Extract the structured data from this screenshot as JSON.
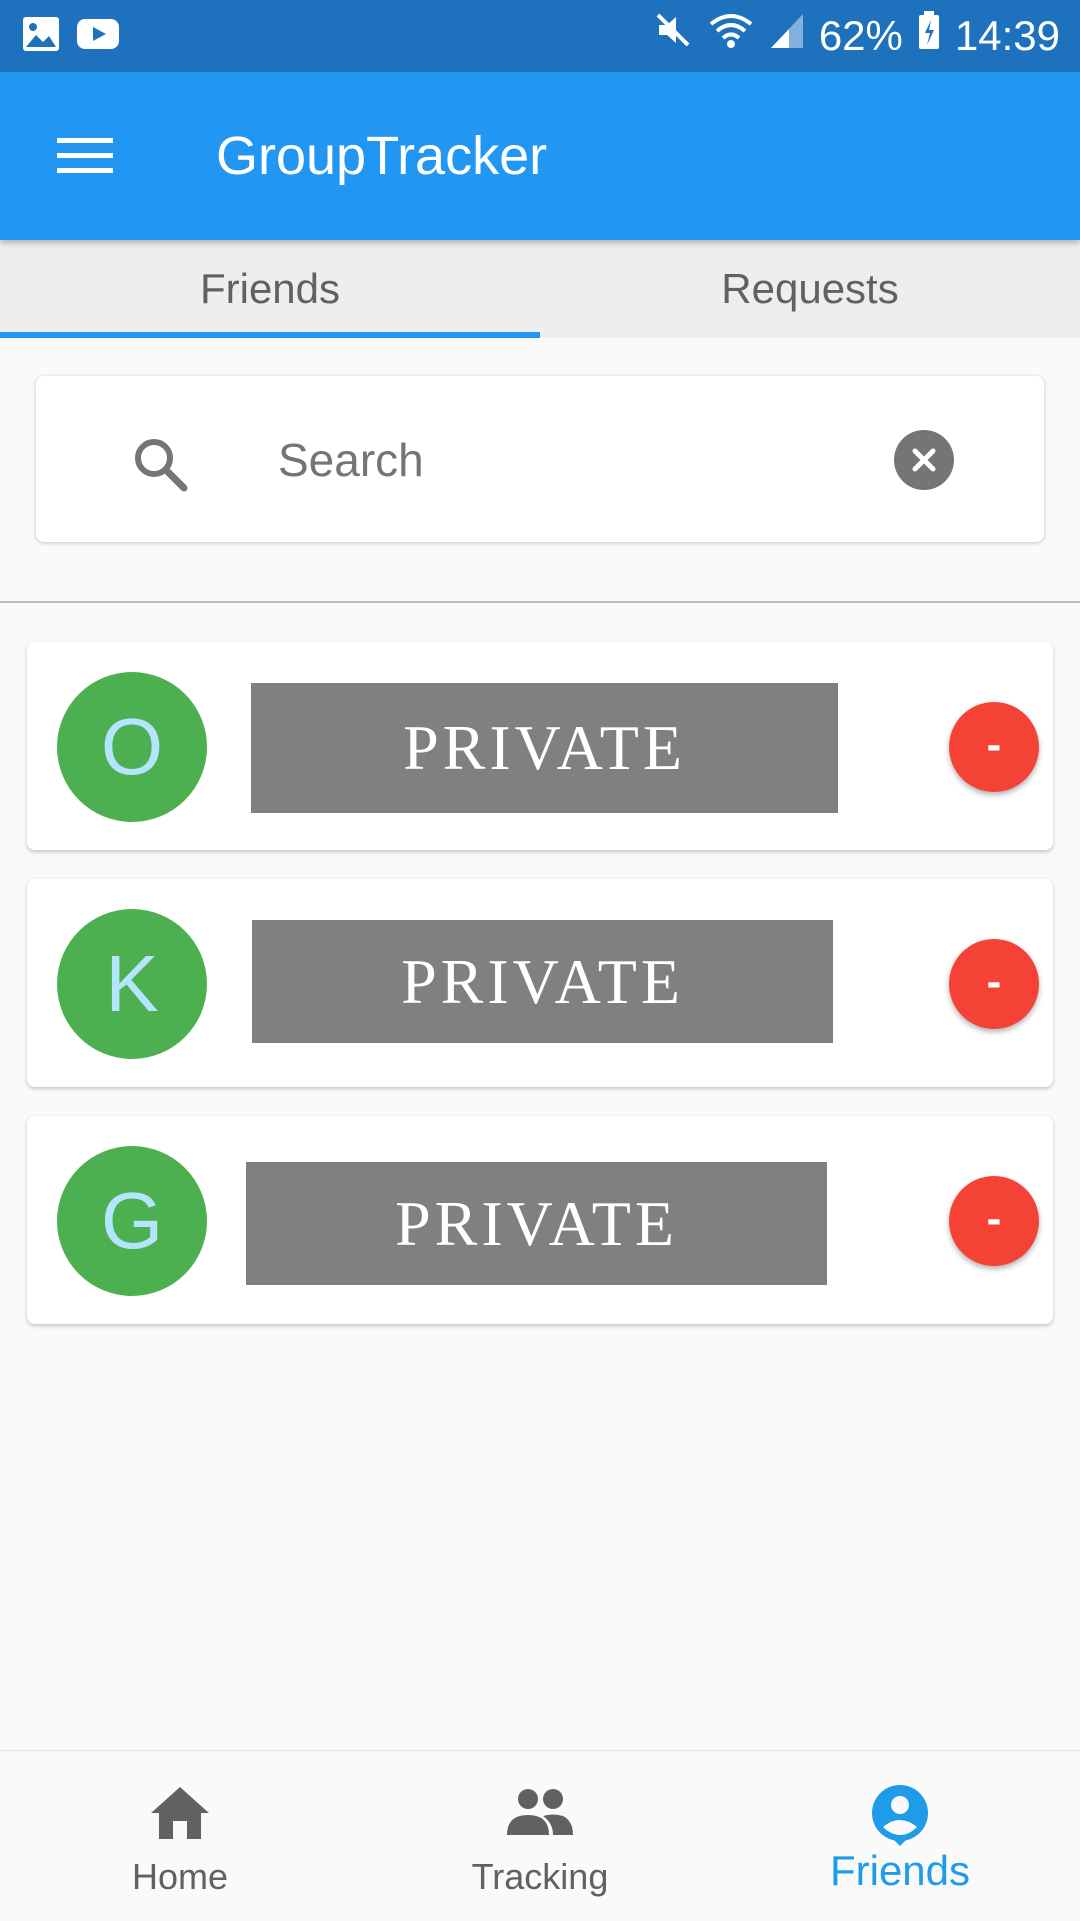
{
  "status_bar": {
    "battery": "62%",
    "time": "14:39",
    "icons": [
      "gallery-icon",
      "youtube-icon",
      "mute-icon",
      "wifi-icon",
      "signal-icon",
      "battery-icon"
    ]
  },
  "app_bar": {
    "title": "GroupTracker",
    "menu_icon": "hamburger-menu-icon"
  },
  "tabs": [
    {
      "label": "Friends",
      "selected": true
    },
    {
      "label": "Requests",
      "selected": false
    }
  ],
  "search": {
    "placeholder": "Search",
    "value": ""
  },
  "friends": [
    {
      "initial": "O",
      "name": "PRIVATE",
      "remove_label": "-"
    },
    {
      "initial": "K",
      "name": "PRIVATE",
      "remove_label": "-"
    },
    {
      "initial": "G",
      "name": "PRIVATE",
      "remove_label": "-"
    }
  ],
  "bottom_nav": [
    {
      "label": "Home",
      "icon": "home-icon",
      "active": false
    },
    {
      "label": "Tracking",
      "icon": "people-icon",
      "active": false
    },
    {
      "label": "Friends",
      "icon": "account-circle-icon",
      "active": true
    }
  ],
  "colors": {
    "status_bar": "#1e72bd",
    "primary": "#2196f3",
    "avatar": "#4caf50",
    "remove_button": "#f44336",
    "active_nav": "#1e9be9"
  }
}
